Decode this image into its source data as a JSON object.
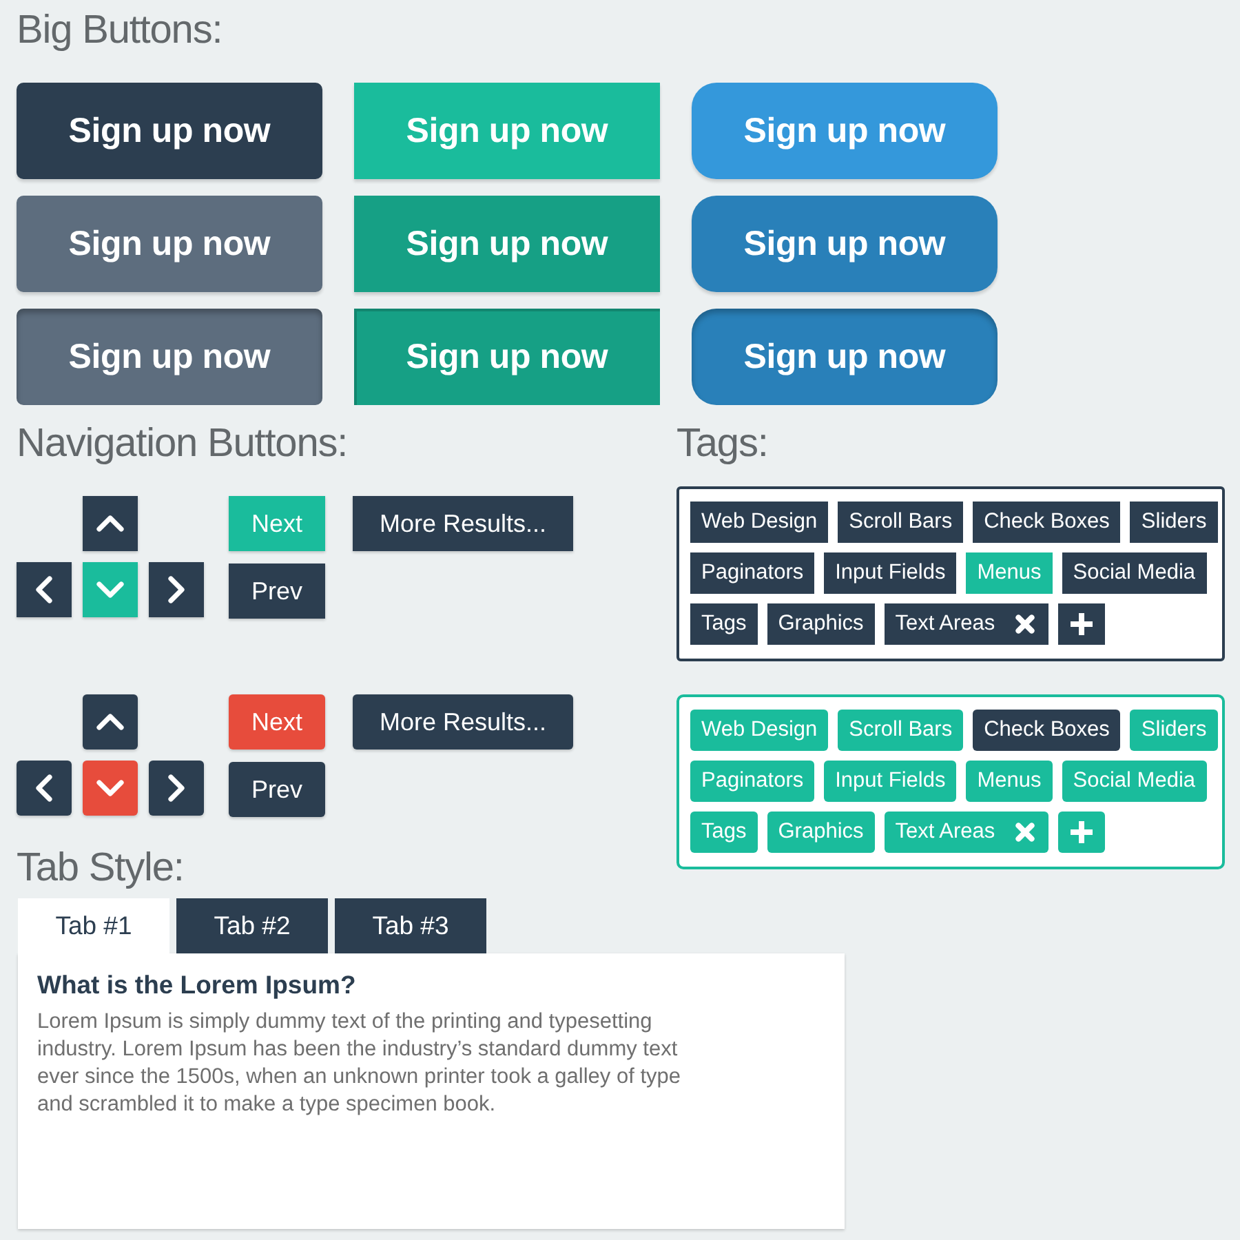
{
  "big_buttons": {
    "heading": "Big Buttons:",
    "buttons": [
      {
        "label": "Sign up now",
        "kind": "dark",
        "hovered": false,
        "pressed": false
      },
      {
        "label": "Sign up now",
        "kind": "teal",
        "hovered": false,
        "pressed": false
      },
      {
        "label": "Sign up now",
        "kind": "blue",
        "hovered": false,
        "pressed": false
      },
      {
        "label": "Sign up now",
        "kind": "dark",
        "hovered": true,
        "pressed": false
      },
      {
        "label": "Sign up now",
        "kind": "teal",
        "hovered": true,
        "pressed": false
      },
      {
        "label": "Sign up now",
        "kind": "blue",
        "hovered": true,
        "pressed": false
      },
      {
        "label": "Sign up now",
        "kind": "dark",
        "hovered": true,
        "pressed": true
      },
      {
        "label": "Sign up now",
        "kind": "teal",
        "hovered": true,
        "pressed": true
      },
      {
        "label": "Sign up now",
        "kind": "blue",
        "hovered": true,
        "pressed": true
      }
    ]
  },
  "navigation": {
    "heading": "Navigation Buttons:",
    "groups": [
      {
        "kind": "teal",
        "arrows": [
          {
            "kind": "up",
            "selected": false
          },
          {
            "kind": "left",
            "selected": false
          },
          {
            "kind": "down",
            "selected": true
          },
          {
            "kind": "right",
            "selected": false
          }
        ],
        "buttons": [
          {
            "label": "Next",
            "selected": true
          },
          {
            "label": "Prev",
            "selected": false
          },
          {
            "label": "More Results...",
            "selected": false
          }
        ]
      },
      {
        "kind": "red",
        "arrows": [
          {
            "kind": "up",
            "selected": false
          },
          {
            "kind": "left",
            "selected": false
          },
          {
            "kind": "down",
            "selected": true
          },
          {
            "kind": "right",
            "selected": false
          }
        ],
        "buttons": [
          {
            "label": "Next",
            "selected": true
          },
          {
            "label": "Prev",
            "selected": false
          },
          {
            "label": "More Results...",
            "selected": false
          }
        ]
      }
    ]
  },
  "tags": {
    "heading": "Tags:",
    "boxes": [
      {
        "kind": "dark",
        "can_add": true,
        "rows": [
          [
            {
              "label": "Web Design",
              "selected": false,
              "removable": false
            },
            {
              "label": "Scroll Bars",
              "selected": false,
              "removable": false
            },
            {
              "label": "Check Boxes",
              "selected": false,
              "removable": false
            },
            {
              "label": "Sliders",
              "selected": false,
              "removable": false
            }
          ],
          [
            {
              "label": "Paginators",
              "selected": false,
              "removable": false
            },
            {
              "label": "Input Fields",
              "selected": false,
              "removable": false
            },
            {
              "label": "Menus",
              "selected": true,
              "removable": false
            },
            {
              "label": "Social Media",
              "selected": false,
              "removable": false
            }
          ],
          [
            {
              "label": "Tags",
              "selected": false,
              "removable": false
            },
            {
              "label": "Graphics",
              "selected": false,
              "removable": false
            },
            {
              "label": "Text Areas",
              "selected": false,
              "removable": true
            }
          ]
        ]
      },
      {
        "kind": "teal",
        "can_add": true,
        "rows": [
          [
            {
              "label": "Web Design",
              "selected": false,
              "removable": false
            },
            {
              "label": "Scroll Bars",
              "selected": false,
              "removable": false
            },
            {
              "label": "Check Boxes",
              "selected": true,
              "removable": false
            },
            {
              "label": "Sliders",
              "selected": false,
              "removable": false
            }
          ],
          [
            {
              "label": "Paginators",
              "selected": false,
              "removable": false
            },
            {
              "label": "Input Fields",
              "selected": false,
              "removable": false
            },
            {
              "label": "Menus",
              "selected": false,
              "removable": false
            },
            {
              "label": "Social Media",
              "selected": false,
              "removable": false
            }
          ],
          [
            {
              "label": "Tags",
              "selected": false,
              "removable": false
            },
            {
              "label": "Graphics",
              "selected": false,
              "removable": false
            },
            {
              "label": "Text Areas",
              "selected": false,
              "removable": true
            }
          ]
        ]
      }
    ]
  },
  "tab_style": {
    "heading": "Tab Style:",
    "tabs": [
      {
        "label": "Tab #1",
        "selected": true
      },
      {
        "label": "Tab #2",
        "selected": false
      },
      {
        "label": "Tab #3",
        "selected": false
      }
    ],
    "panel": {
      "title": "What is the Lorem Ipsum?",
      "text": "Lorem Ipsum is simply dummy text of the printing and typesetting industry. Lorem Ipsum has been the industry’s standard dummy text ever since the 1500s, when an unknown printer took a galley of type and scrambled it to make a type specimen book."
    }
  }
}
